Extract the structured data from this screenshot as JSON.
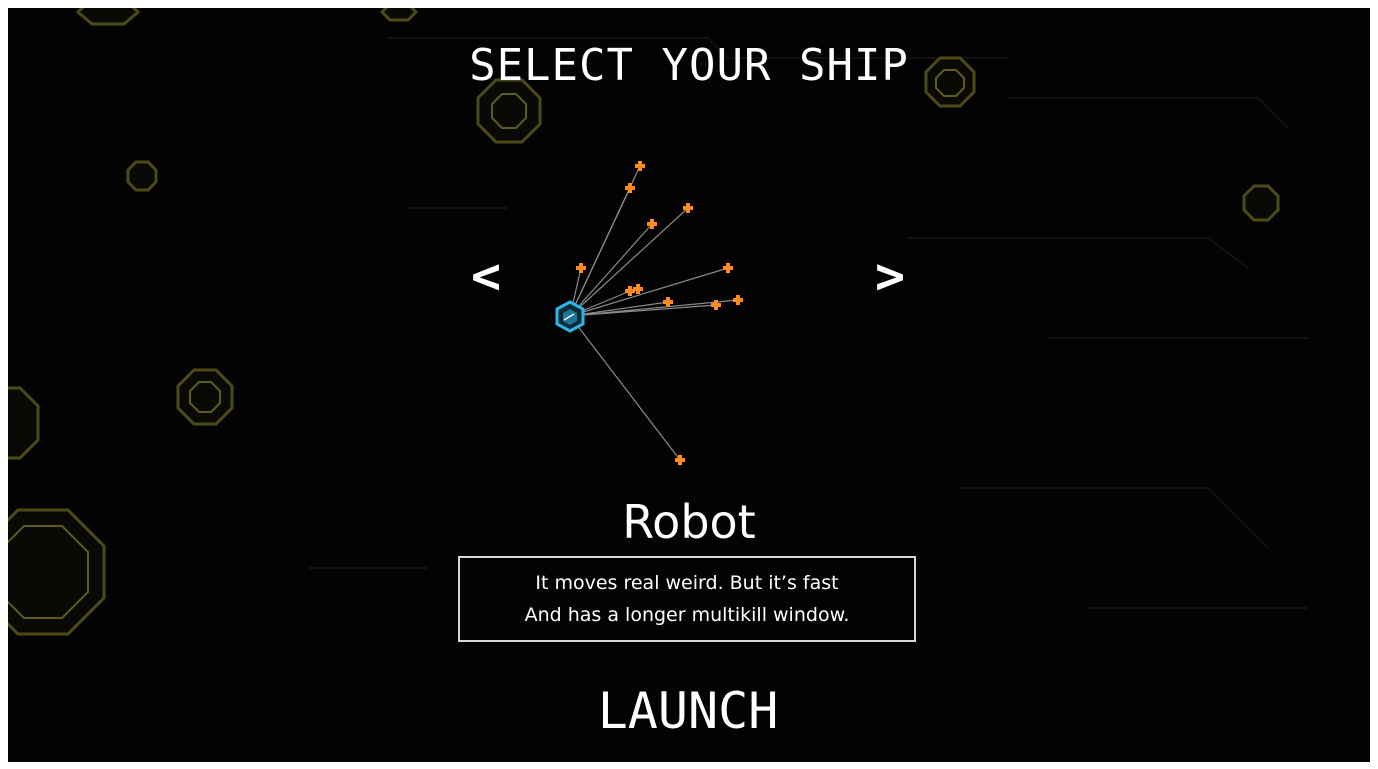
{
  "screen": {
    "title": "SELECT YOUR SHIP",
    "prev_label": "<",
    "next_label": ">",
    "ship_name": "Robot",
    "description_line1": "It moves real weird. But it’s fast",
    "description_line2": "And has a longer multikill window.",
    "launch_label": "LAUNCH"
  },
  "colors": {
    "background": "#030303",
    "text": "#ffffff",
    "ship": "#2fb4e6",
    "spark": "#ff8a1e",
    "tether": "#8a8a8a",
    "bg_octagon": "#6b6b1c",
    "panel_border": "#d8d8d8"
  },
  "icons": {
    "prev": "chevron-left-icon",
    "next": "chevron-right-icon",
    "ship": "hexagon-ship-icon",
    "spark": "orange-cross-spark-icon",
    "background_decor": "octagon-ring-icon"
  }
}
